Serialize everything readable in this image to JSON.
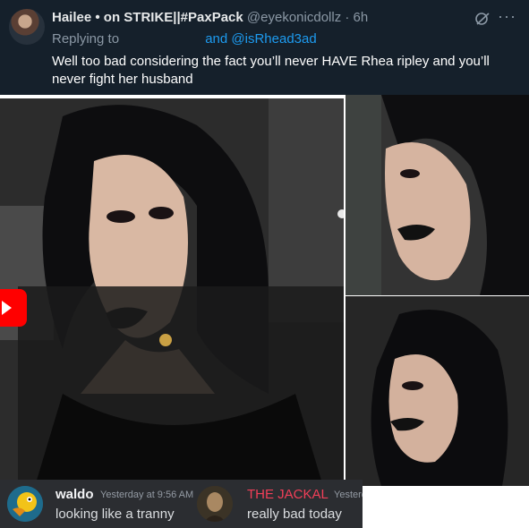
{
  "tweet": {
    "display_name": "Hailee • on STRIKE||#PaxPack",
    "handle": "@eyekonicdollz",
    "separator": "·",
    "time": "6h",
    "replying_to_label": "Replying to",
    "replying_to_mentions": "and @isRhead3ad",
    "text": "Well too bad considering the fact you’ll never HAVE Rhea ripley and you’ll never fight her husband",
    "more_glyph": "···"
  },
  "photos": [
    {
      "name": "photo-main"
    },
    {
      "name": "photo-top-right"
    },
    {
      "name": "photo-bottom-right"
    }
  ],
  "discord": {
    "messages": [
      {
        "username": "waldo",
        "timestamp": "Yesterday at 9:56 AM",
        "text": "looking like a tranny",
        "username_color": "#f2f3f5"
      },
      {
        "username": "THE JACKAL",
        "timestamp": "Yesterday",
        "text": "really bad today",
        "username_color": "#f23f58"
      }
    ]
  },
  "colors": {
    "tweet_bg": "#15202b",
    "link_blue": "#1d9bf0",
    "discord_bg": "#2b2d31",
    "youtube_red": "#ff0000"
  }
}
